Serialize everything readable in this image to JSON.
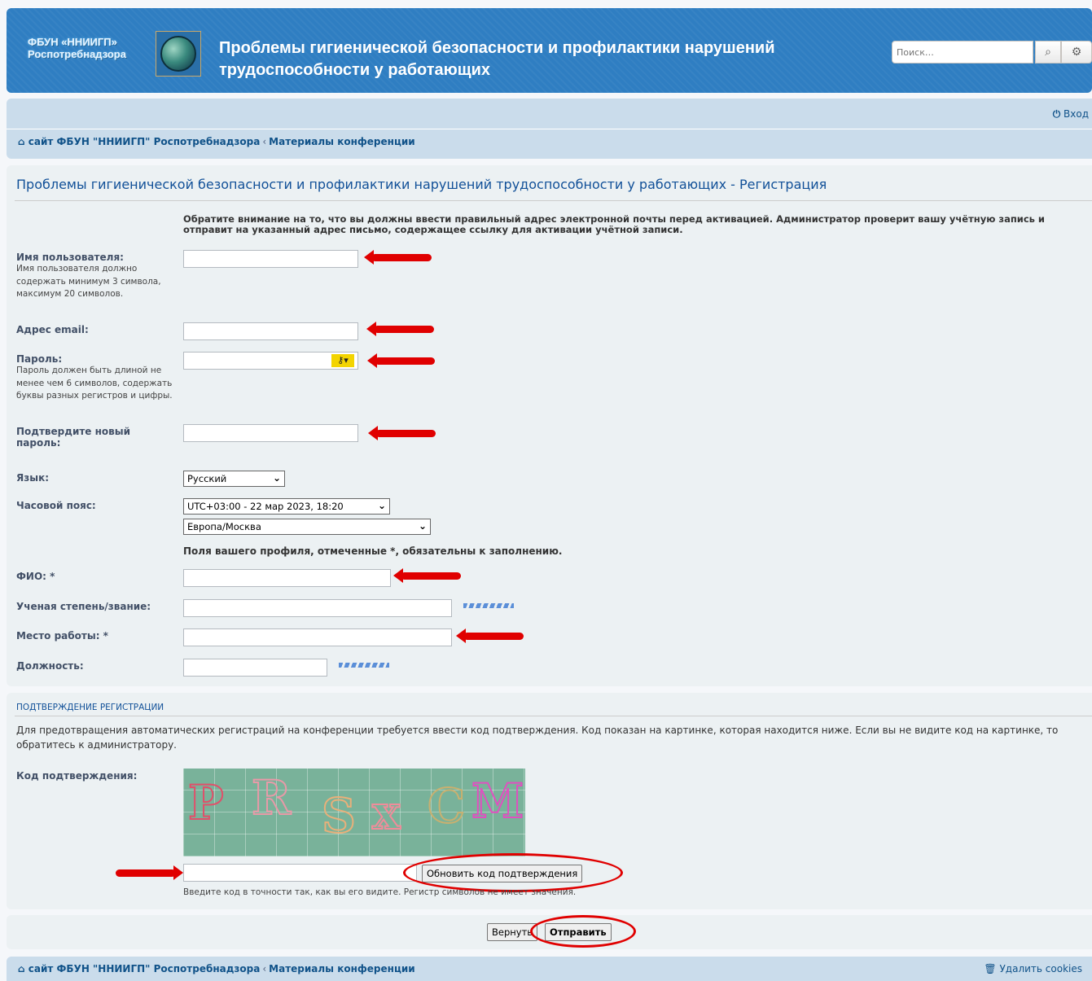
{
  "header": {
    "logo_text": "ФБУН «ННИИГП» Роспотребнадзора",
    "site_title": "Проблемы гигиенической безопасности и профилактики нарушений трудоспособности у работающих",
    "search_placeholder": "Поиск…"
  },
  "nav": {
    "login": "Вход",
    "crumb1": "сайт ФБУН \"ННИИГП\" Роспотребнадзора",
    "crumb_sep": "‹",
    "crumb2": "Материалы конференции"
  },
  "form": {
    "page_title": "Проблемы гигиенической безопасности и профилактики нарушений трудоспособности у работающих - Регистрация",
    "notice": "Обратите внимание на то, что вы должны ввести правильный адрес электронной почты перед активацией. Администратор проверит вашу учётную запись и отправит на указанный адрес письмо, содержащее ссылку для активации учётной записи.",
    "username_label": "Имя пользователя:",
    "username_hint": "Имя пользователя должно содержать минимум 3 символа, максимум 20 символов.",
    "email_label": "Адрес email:",
    "password_label": "Пароль:",
    "password_hint": "Пароль должен быть длиной не менее чем 6 символов, содержать буквы разных регистров и цифры.",
    "confirm_label": "Подтвердите новый пароль:",
    "language_label": "Язык:",
    "language_value": "Русский",
    "timezone_label": "Часовой пояс:",
    "timezone_value": "UTC+03:00 - 22 мар 2023, 18:20",
    "region_value": "Европа/Москва",
    "required_note": "Поля вашего профиля, отмеченные *, обязательны к заполнению.",
    "fio_label": "ФИО: *",
    "degree_label": "Ученая степень/звание:",
    "workplace_label": "Место работы: *",
    "position_label": "Должность:"
  },
  "captcha": {
    "section_head": "ПОДТВЕРЖДЕНИЕ РЕГИСТРАЦИИ",
    "text": "Для предотвращения автоматических регистраций на конференции требуется ввести код подтверждения. Код показан на картинке, которая находится ниже. Если вы не видите код на картинке, то обратитесь к администратору.",
    "label": "Код подтверждения:",
    "refresh_button": "Обновить код подтверждения",
    "hint": "Введите код в точности так, как вы его видите. Регистр символов не имеет значения.",
    "chars": [
      "P",
      "R",
      "S",
      "x",
      "C",
      "M"
    ]
  },
  "actions": {
    "back_button": "Вернуть",
    "submit_button": "Отправить"
  },
  "footer": {
    "cookies": "Удалить cookies"
  },
  "colors": {
    "header_bg": "#2f7ec2",
    "nav_bg": "#cadceb",
    "panel_bg": "#ecf1f3",
    "link": "#105289",
    "annotation_red": "#e00000"
  }
}
